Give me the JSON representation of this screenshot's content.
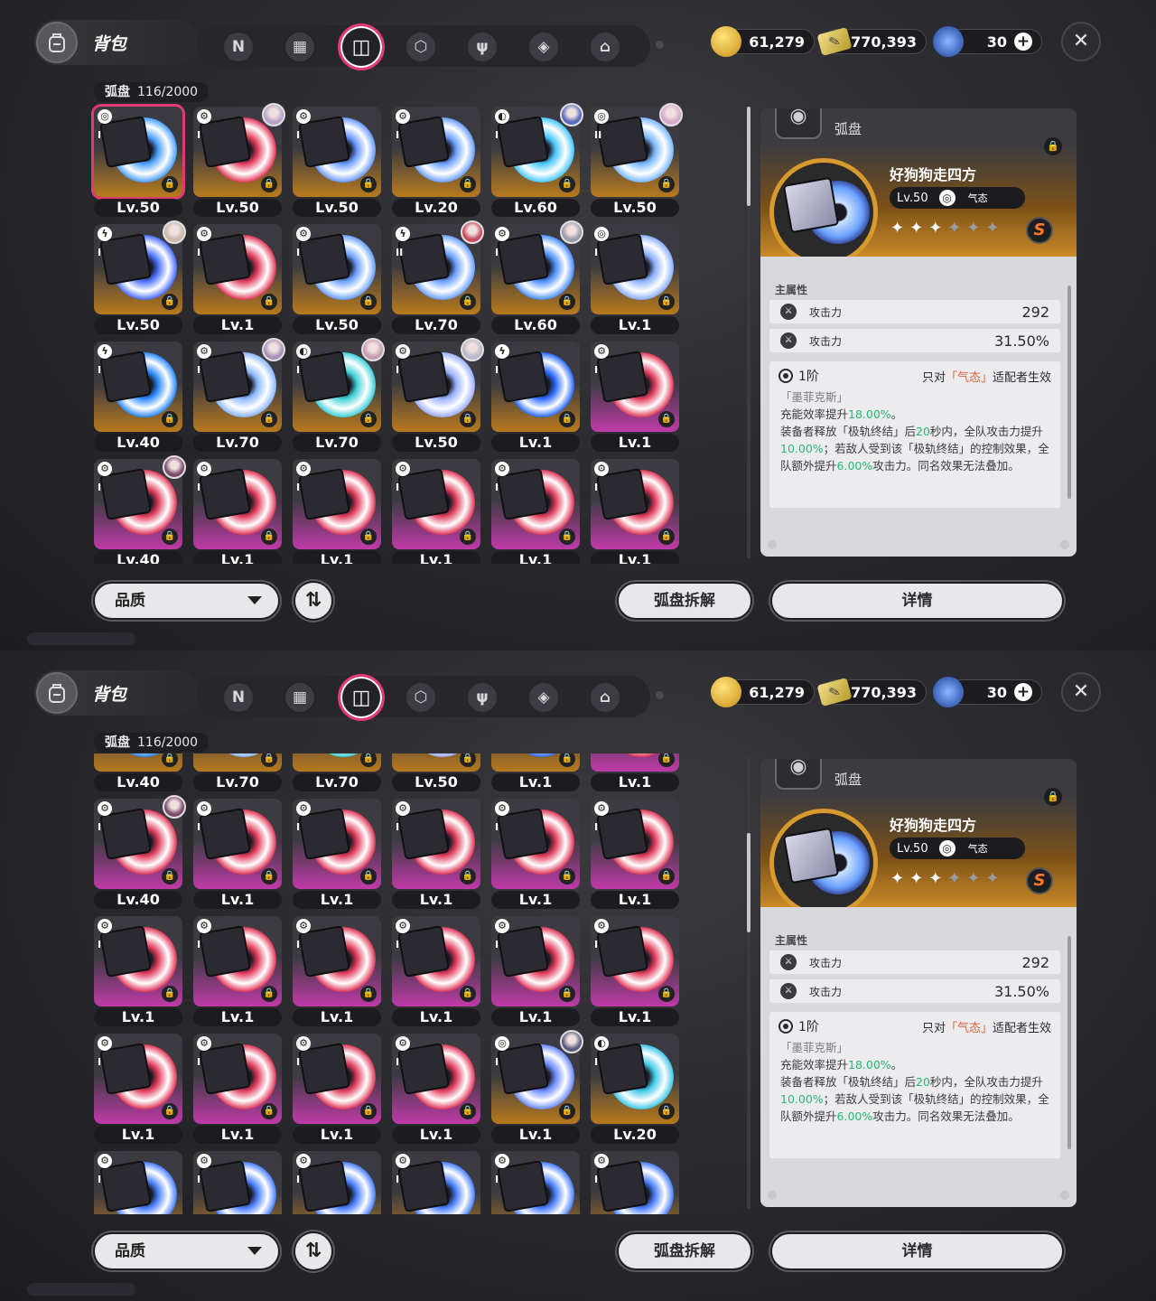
{
  "header": {
    "bag_title": "背包",
    "tabs": [
      "N",
      "▦",
      "◫",
      "⬡",
      "ψ",
      "◈",
      "⌂"
    ],
    "active_tab": 2,
    "currency": [
      {
        "icon": "gold-coin-icon",
        "value": "61,279"
      },
      {
        "icon": "ticket-icon",
        "value": "770,393"
      },
      {
        "icon": "energy-orb-icon",
        "value": "30"
      }
    ],
    "close_label": "✕"
  },
  "inventory": {
    "category": "弧盘",
    "count": "116/2000"
  },
  "screens": [
    {
      "rows": [
        [
          {
            "lv": "Lv.50",
            "rarity": "A",
            "num": "I",
            "type": "◎",
            "avatar": null,
            "hue": "#4aa0ff",
            "selected": true
          },
          {
            "lv": "Lv.50",
            "rarity": "A",
            "num": "I",
            "type": "⚙",
            "avatar": "#b6a2c8",
            "hue": "#e03a5a"
          },
          {
            "lv": "Lv.50",
            "rarity": "A",
            "num": "I",
            "type": "⚙",
            "avatar": null,
            "hue": "#6a9aff"
          },
          {
            "lv": "Lv.20",
            "rarity": "A",
            "num": "I",
            "type": "⚙",
            "avatar": null,
            "hue": "#6aa0ff"
          },
          {
            "lv": "Lv.60",
            "rarity": "A",
            "num": "I",
            "type": "◐",
            "avatar": "#5a6ab8",
            "hue": "#48c8ff"
          },
          {
            "lv": "Lv.50",
            "rarity": "A",
            "num": "II",
            "type": "◎",
            "avatar": "#d8a8c8",
            "hue": "#78b8ff"
          }
        ],
        [
          {
            "lv": "Lv.50",
            "rarity": "A",
            "num": "I",
            "type": "ϟ",
            "avatar": "#c8b8a8",
            "hue": "#4a70ff"
          },
          {
            "lv": "Lv.1",
            "rarity": "A",
            "num": "I",
            "type": "⚙",
            "avatar": null,
            "hue": "#e03a5a"
          },
          {
            "lv": "Lv.50",
            "rarity": "A",
            "num": "I",
            "type": "⚙",
            "avatar": null,
            "hue": "#6aa0ff"
          },
          {
            "lv": "Lv.70",
            "rarity": "A",
            "num": "II",
            "type": "ϟ",
            "avatar": "#c84a5a",
            "hue": "#6aa0ff"
          },
          {
            "lv": "Lv.60",
            "rarity": "A",
            "num": "I",
            "type": "⚙",
            "avatar": "#9a9aa8",
            "hue": "#4a90ff"
          },
          {
            "lv": "Lv.1",
            "rarity": "A",
            "num": "I",
            "type": "◎",
            "avatar": null,
            "hue": "#8ab0ff"
          }
        ],
        [
          {
            "lv": "Lv.40",
            "rarity": "A",
            "num": "I",
            "type": "ϟ",
            "avatar": null,
            "hue": "#2a8aff"
          },
          {
            "lv": "Lv.70",
            "rarity": "A",
            "num": "I",
            "type": "⚙",
            "avatar": "#a890b8",
            "hue": "#8ab8ff"
          },
          {
            "lv": "Lv.70",
            "rarity": "A",
            "num": "I",
            "type": "◐",
            "avatar": "#c89ab0",
            "hue": "#40d0d8"
          },
          {
            "lv": "Lv.50",
            "rarity": "A",
            "num": "I",
            "type": "⚙",
            "avatar": "#b8b8c8",
            "hue": "#9ab0ff"
          },
          {
            "lv": "Lv.1",
            "rarity": "A",
            "num": "I",
            "type": "ϟ",
            "avatar": null,
            "hue": "#2a6aff"
          },
          {
            "lv": "Lv.1",
            "rarity": "B",
            "num": "I",
            "type": "⚙",
            "avatar": null,
            "hue": "#e03a5a"
          }
        ],
        [
          {
            "lv": "Lv.40",
            "rarity": "B",
            "num": "I",
            "type": "⚙",
            "avatar": "#7a4a6a",
            "hue": "#e03a5a"
          },
          {
            "lv": "Lv.1",
            "rarity": "B",
            "num": "I",
            "type": "⚙",
            "avatar": null,
            "hue": "#e03a5a"
          },
          {
            "lv": "Lv.1",
            "rarity": "B",
            "num": "I",
            "type": "⚙",
            "avatar": null,
            "hue": "#e03a5a"
          },
          {
            "lv": "Lv.1",
            "rarity": "B",
            "num": "I",
            "type": "⚙",
            "avatar": null,
            "hue": "#e03a5a"
          },
          {
            "lv": "Lv.1",
            "rarity": "B",
            "num": "I",
            "type": "⚙",
            "avatar": null,
            "hue": "#e03a5a"
          },
          {
            "lv": "Lv.1",
            "rarity": "B",
            "num": "I",
            "type": "⚙",
            "avatar": null,
            "hue": "#e03a5a"
          }
        ]
      ]
    },
    {
      "rows": [
        [
          {
            "lv": "Lv.40",
            "rarity": "A",
            "num": "I",
            "type": "ϟ",
            "avatar": null,
            "hue": "#2a8aff"
          },
          {
            "lv": "Lv.70",
            "rarity": "A",
            "num": "I",
            "type": "⚙",
            "avatar": null,
            "hue": "#8ab8ff"
          },
          {
            "lv": "Lv.70",
            "rarity": "A",
            "num": "I",
            "type": "◐",
            "avatar": null,
            "hue": "#40d0d8"
          },
          {
            "lv": "Lv.50",
            "rarity": "A",
            "num": "I",
            "type": "⚙",
            "avatar": null,
            "hue": "#9ab0ff"
          },
          {
            "lv": "Lv.1",
            "rarity": "A",
            "num": "I",
            "type": "ϟ",
            "avatar": null,
            "hue": "#2a6aff"
          },
          {
            "lv": "Lv.1",
            "rarity": "B",
            "num": "I",
            "type": "⚙",
            "avatar": null,
            "hue": "#e03a5a"
          }
        ],
        [
          {
            "lv": "Lv.40",
            "rarity": "B",
            "num": "I",
            "type": "⚙",
            "avatar": "#7a4a6a",
            "hue": "#e03a5a"
          },
          {
            "lv": "Lv.1",
            "rarity": "B",
            "num": "I",
            "type": "⚙",
            "avatar": null,
            "hue": "#e03a5a"
          },
          {
            "lv": "Lv.1",
            "rarity": "B",
            "num": "I",
            "type": "⚙",
            "avatar": null,
            "hue": "#e03a5a"
          },
          {
            "lv": "Lv.1",
            "rarity": "B",
            "num": "I",
            "type": "⚙",
            "avatar": null,
            "hue": "#e03a5a"
          },
          {
            "lv": "Lv.1",
            "rarity": "B",
            "num": "I",
            "type": "⚙",
            "avatar": null,
            "hue": "#e03a5a"
          },
          {
            "lv": "Lv.1",
            "rarity": "B",
            "num": "I",
            "type": "⚙",
            "avatar": null,
            "hue": "#e03a5a"
          }
        ],
        [
          {
            "lv": "Lv.1",
            "rarity": "B",
            "num": "I",
            "type": "⚙",
            "avatar": null,
            "hue": "#e03a5a"
          },
          {
            "lv": "Lv.1",
            "rarity": "B",
            "num": "I",
            "type": "⚙",
            "avatar": null,
            "hue": "#e03a5a"
          },
          {
            "lv": "Lv.1",
            "rarity": "B",
            "num": "I",
            "type": "⚙",
            "avatar": null,
            "hue": "#e03a5a"
          },
          {
            "lv": "Lv.1",
            "rarity": "B",
            "num": "I",
            "type": "⚙",
            "avatar": null,
            "hue": "#e03a5a"
          },
          {
            "lv": "Lv.1",
            "rarity": "B",
            "num": "I",
            "type": "⚙",
            "avatar": null,
            "hue": "#e03a5a"
          },
          {
            "lv": "Lv.1",
            "rarity": "B",
            "num": "I",
            "type": "⚙",
            "avatar": null,
            "hue": "#e03a5a"
          }
        ],
        [
          {
            "lv": "Lv.1",
            "rarity": "B",
            "num": "I",
            "type": "⚙",
            "avatar": null,
            "hue": "#e03a5a"
          },
          {
            "lv": "Lv.1",
            "rarity": "B",
            "num": "I",
            "type": "⚙",
            "avatar": null,
            "hue": "#e03a5a"
          },
          {
            "lv": "Lv.1",
            "rarity": "B",
            "num": "I",
            "type": "⚙",
            "avatar": null,
            "hue": "#e03a5a"
          },
          {
            "lv": "Lv.1",
            "rarity": "B",
            "num": "I",
            "type": "⚙",
            "avatar": null,
            "hue": "#e03a5a"
          },
          {
            "lv": "Lv.1",
            "rarity": "A",
            "num": "I",
            "type": "◎",
            "avatar": "#5a5a7a",
            "hue": "#6a8aff"
          },
          {
            "lv": "Lv.20",
            "rarity": "A",
            "num": "I",
            "type": "◐",
            "avatar": null,
            "hue": "#40c8e8"
          }
        ],
        [
          {
            "lv": "",
            "rarity": "A",
            "num": "I",
            "type": "⚙",
            "avatar": null,
            "hue": "#4a80ff"
          },
          {
            "lv": "",
            "rarity": "A",
            "num": "I",
            "type": "⚙",
            "avatar": null,
            "hue": "#4a80ff"
          },
          {
            "lv": "",
            "rarity": "A",
            "num": "I",
            "type": "⚙",
            "avatar": null,
            "hue": "#4a80ff"
          },
          {
            "lv": "",
            "rarity": "A",
            "num": "I",
            "type": "⚙",
            "avatar": null,
            "hue": "#4a80ff"
          },
          {
            "lv": "",
            "rarity": "A",
            "num": "I",
            "type": "⚙",
            "avatar": null,
            "hue": "#4a80ff"
          },
          {
            "lv": "",
            "rarity": "A",
            "num": "I",
            "type": "⚙",
            "avatar": null,
            "hue": "#4a80ff"
          }
        ]
      ]
    }
  ],
  "detail": {
    "category": "弧盘",
    "name": "好狗狗走四方",
    "level": "Lv.50",
    "attr_name": "气态",
    "stars_filled": 3,
    "stars_total": 6,
    "rank": "S",
    "main_stat_title": "主属性",
    "stats": [
      {
        "name": "攻击力",
        "value": "292"
      },
      {
        "name": "攻击力",
        "value": "31.50%"
      }
    ],
    "effect": {
      "tier": "1阶",
      "cond_prefix": "只对",
      "cond_attr": "「气态」",
      "cond_suffix": "适配者生效",
      "source": "「墨菲克斯」",
      "line1_a": "充能效率提升",
      "line1_v": "18.00%",
      "line1_b": "。",
      "line2_a": "装备者释放「极轨终结」后",
      "line2_v1": "20",
      "line2_b": "秒内，全队攻击力提升",
      "line2_v2": "10.00%",
      "line2_c": "；若敌人受到该「极轨终结」的控制效果，全队额外提升",
      "line2_v3": "6.00%",
      "line2_d": "攻击力。同名效果无法叠加。"
    }
  },
  "buttons": {
    "quality": "品质",
    "sort": "⇅",
    "dismantle": "弧盘拆解",
    "details": "详情"
  },
  "colors": {
    "accent": "#e23a74",
    "gold_card": "#b97a1e",
    "purple_card": "#c03aa8",
    "highlight_green": "#2bb673",
    "attr_orange": "#e0603a"
  }
}
